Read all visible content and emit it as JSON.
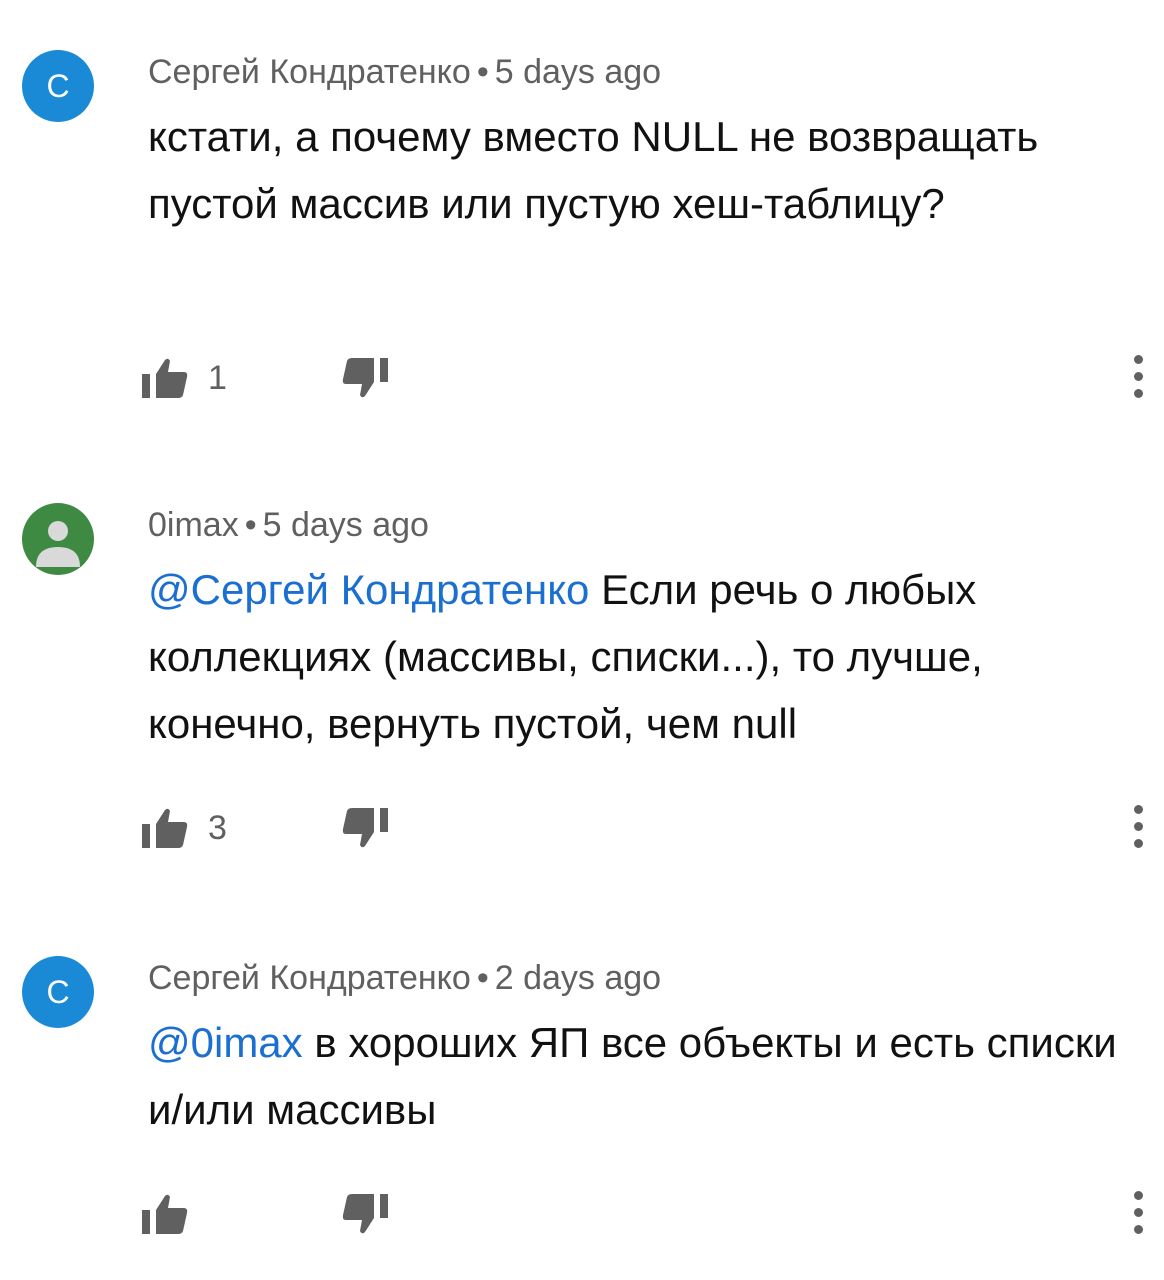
{
  "comments": [
    {
      "avatar_letter": "С",
      "avatar_color": "#1a8ad6",
      "author": "Сергей Кондратенко",
      "separator": "•",
      "time": "5 days ago",
      "mention": "",
      "text": "кстати, а почему вместо NULL не возвращать пустой массив или пустую хеш-таблицу?",
      "likes": "1",
      "like_icon": "thumbs-up-icon",
      "dislike_icon": "thumbs-down-icon",
      "more_icon": "more-vertical-icon"
    },
    {
      "avatar_letter": "",
      "avatar_color": "#3f8a43",
      "author": "0imax",
      "separator": "•",
      "time": "5 days ago",
      "mention": "@Сергей Кондратенко",
      "text": " Если речь о любых коллекциях (массивы, списки...), то лучше, конечно, вернуть пустой, чем null",
      "likes": "3",
      "like_icon": "thumbs-up-icon",
      "dislike_icon": "thumbs-down-icon",
      "more_icon": "more-vertical-icon"
    },
    {
      "avatar_letter": "С",
      "avatar_color": "#1a8ad6",
      "author": "Сергей Кондратенко",
      "separator": "•",
      "time": "2 days ago",
      "mention": "@0imax",
      "text": " в хороших ЯП все объекты и есть списки и/или массивы",
      "likes": "",
      "like_icon": "thumbs-up-icon",
      "dislike_icon": "thumbs-down-icon",
      "more_icon": "more-vertical-icon"
    }
  ]
}
